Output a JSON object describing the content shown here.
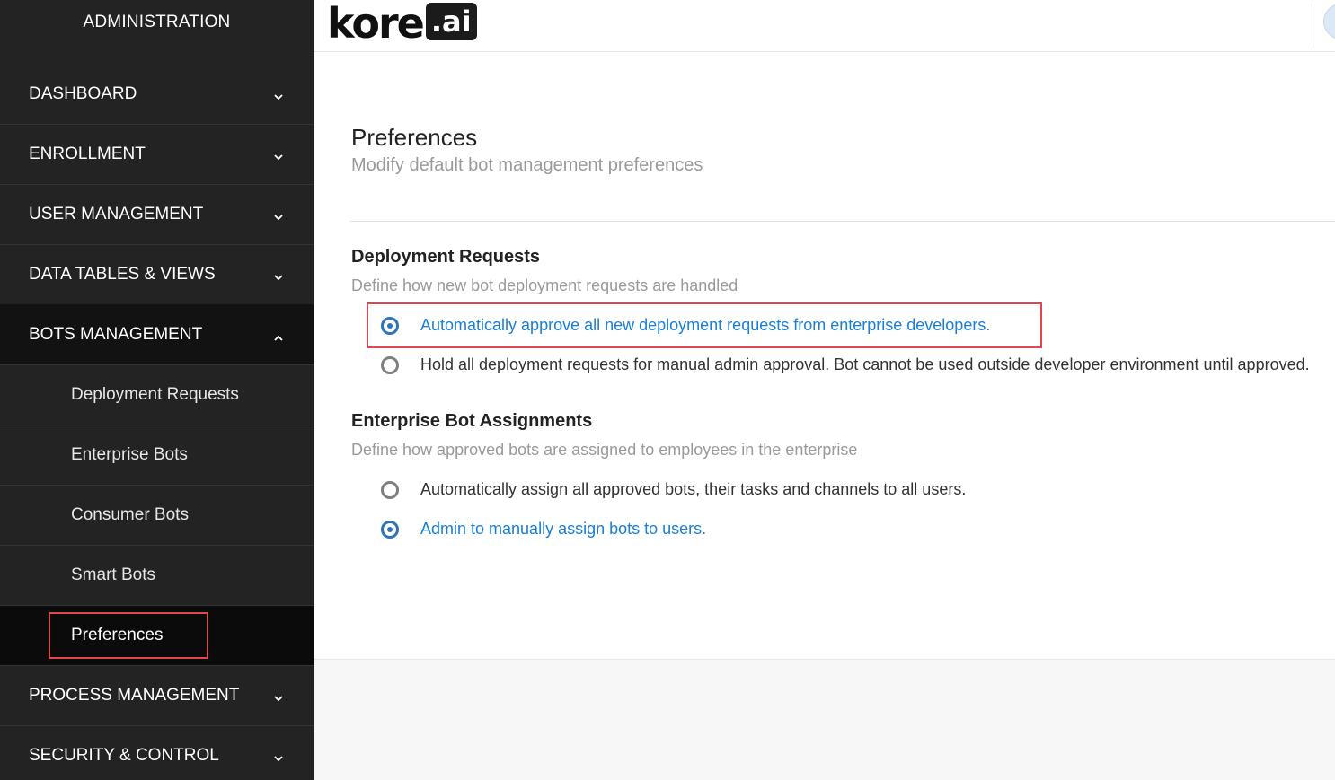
{
  "sidebar": {
    "title": "ADMINISTRATION",
    "items": [
      {
        "label": "DASHBOARD"
      },
      {
        "label": "ENROLLMENT"
      },
      {
        "label": "USER MANAGEMENT"
      },
      {
        "label": "DATA TABLES & VIEWS"
      },
      {
        "label": "BOTS MANAGEMENT"
      },
      {
        "label": "PROCESS MANAGEMENT"
      },
      {
        "label": "SECURITY & CONTROL"
      }
    ],
    "bots_submenu": [
      {
        "label": "Deployment Requests"
      },
      {
        "label": "Enterprise Bots"
      },
      {
        "label": "Consumer Bots"
      },
      {
        "label": "Smart Bots"
      },
      {
        "label": "Preferences"
      }
    ]
  },
  "header": {
    "logo_text": "kore",
    "logo_suffix": ".ai"
  },
  "main": {
    "title": "Preferences",
    "subtitle": "Modify default bot management preferences",
    "deployment": {
      "title": "Deployment Requests",
      "description": "Define how new bot deployment requests are handled",
      "options": [
        {
          "label": "Automatically approve all new deployment requests from enterprise developers.",
          "selected": true
        },
        {
          "label": "Hold all deployment requests for manual admin approval. Bot cannot be used outside developer environment until approved.",
          "selected": false
        }
      ]
    },
    "assignment": {
      "title": "Enterprise Bot Assignments",
      "description": "Define how approved bots are assigned to employees in the enterprise",
      "options": [
        {
          "label": "Automatically assign all approved bots, their tasks and channels to all users.",
          "selected": false
        },
        {
          "label": "Admin to manually assign bots to users.",
          "selected": true
        }
      ]
    }
  }
}
